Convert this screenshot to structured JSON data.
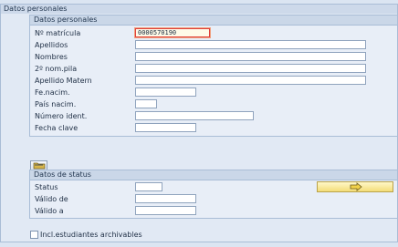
{
  "outer_title": "Datos personales",
  "personal": {
    "header": "Datos personales",
    "rows": [
      {
        "label": "Nº matrícula",
        "value": "0000570190"
      },
      {
        "label": "Apellidos",
        "value": ""
      },
      {
        "label": "Nombres",
        "value": ""
      },
      {
        "label": "2º nom.pila",
        "value": ""
      },
      {
        "label": "Apellido Matern",
        "value": ""
      },
      {
        "label": "Fe.nacim.",
        "value": ""
      },
      {
        "label": "País nacim.",
        "value": ""
      },
      {
        "label": "Número ident.",
        "value": ""
      },
      {
        "label": "Fecha clave",
        "value": ""
      }
    ]
  },
  "status": {
    "header": "Datos de status",
    "rows": [
      {
        "label": "Status",
        "value": ""
      },
      {
        "label": "Válido de",
        "value": ""
      },
      {
        "label": "Válido a",
        "value": ""
      }
    ]
  },
  "checkbox": {
    "label": "Incl.estudiantes archivables",
    "checked": false
  },
  "icons": {
    "folder_button": "folder-icon",
    "execute_button": "arrow-right-icon"
  }
}
